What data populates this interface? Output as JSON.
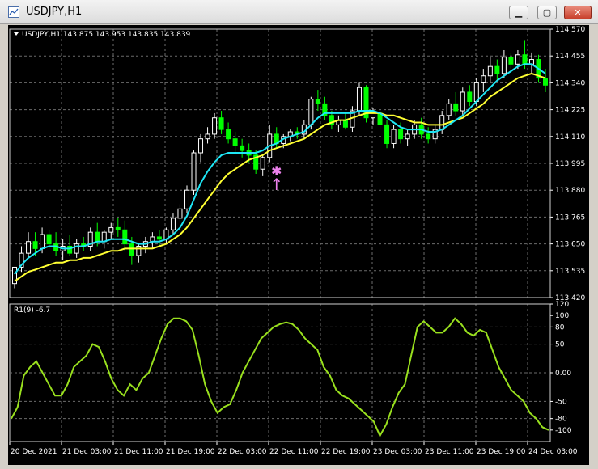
{
  "window": {
    "title": "USDJPY,H1",
    "min_glyph": "▁",
    "max_glyph": "▢",
    "close_glyph": "✕",
    "icon": "chart-app-icon"
  },
  "colors": {
    "bg": "#000000",
    "grid": "#6b6b6b",
    "bull": "#ffffff",
    "bear": "#00ff00",
    "ma_fast": "#1ee6f5",
    "ma_slow": "#ffff32",
    "indicator": "#99e01e",
    "signal": "#ee82ee"
  },
  "chart_data": [
    {
      "type": "candlestick",
      "symbol_label": "USDJPY,H1",
      "ohlc_label": "143.875 143.953 143.835 143.839",
      "y_ticks": [
        "114.570",
        "114.455",
        "114.340",
        "114.225",
        "114.110",
        "113.995",
        "113.880",
        "113.765",
        "113.650",
        "113.535",
        "113.420"
      ],
      "ylim": [
        113.42,
        114.57
      ],
      "x_ticks": [
        "20 Dec 2021",
        "21 Dec 03:00",
        "21 Dec 11:00",
        "21 Dec 19:00",
        "22 Dec 03:00",
        "22 Dec 11:00",
        "22 Dec 19:00",
        "23 Dec 03:00",
        "23 Dec 11:00",
        "23 Dec 19:00",
        "24 Dec 03:00"
      ],
      "candles": [
        [
          113.48,
          113.55,
          113.46,
          113.55
        ],
        [
          113.55,
          113.64,
          113.53,
          113.61
        ],
        [
          113.61,
          113.7,
          113.59,
          113.66
        ],
        [
          113.66,
          113.7,
          113.6,
          113.63
        ],
        [
          113.63,
          113.72,
          113.61,
          113.69
        ],
        [
          113.69,
          113.71,
          113.63,
          113.65
        ],
        [
          113.65,
          113.7,
          113.6,
          113.62
        ],
        [
          113.62,
          113.67,
          113.58,
          113.64
        ],
        [
          113.64,
          113.69,
          113.6,
          113.61
        ],
        [
          113.61,
          113.67,
          113.59,
          113.65
        ],
        [
          113.65,
          113.68,
          113.62,
          113.64
        ],
        [
          113.64,
          113.72,
          113.62,
          113.7
        ],
        [
          113.7,
          113.74,
          113.64,
          113.66
        ],
        [
          113.66,
          113.71,
          113.63,
          113.7
        ],
        [
          113.7,
          113.74,
          113.67,
          113.72
        ],
        [
          113.72,
          113.76,
          113.68,
          113.71
        ],
        [
          113.71,
          113.75,
          113.62,
          113.65
        ],
        [
          113.65,
          113.68,
          113.56,
          113.6
        ],
        [
          113.6,
          113.65,
          113.57,
          113.64
        ],
        [
          113.64,
          113.68,
          113.61,
          113.66
        ],
        [
          113.66,
          113.7,
          113.63,
          113.68
        ],
        [
          113.68,
          113.71,
          113.64,
          113.67
        ],
        [
          113.67,
          113.72,
          113.65,
          113.71
        ],
        [
          113.71,
          113.78,
          113.69,
          113.76
        ],
        [
          113.76,
          113.82,
          113.74,
          113.8
        ],
        [
          113.8,
          113.9,
          113.78,
          113.88
        ],
        [
          113.88,
          114.05,
          113.86,
          114.04
        ],
        [
          114.04,
          114.12,
          114.0,
          114.1
        ],
        [
          114.1,
          114.15,
          114.08,
          114.12
        ],
        [
          114.12,
          114.21,
          114.1,
          114.19
        ],
        [
          114.19,
          114.22,
          114.12,
          114.14
        ],
        [
          114.14,
          114.17,
          114.08,
          114.1
        ],
        [
          114.1,
          114.13,
          114.04,
          114.07
        ],
        [
          114.07,
          114.1,
          114.02,
          114.05
        ],
        [
          114.05,
          114.08,
          114.0,
          114.03
        ],
        [
          114.03,
          114.05,
          113.95,
          113.97
        ],
        [
          113.97,
          114.03,
          113.94,
          114.02
        ],
        [
          114.02,
          114.16,
          114.0,
          114.12
        ],
        [
          114.12,
          114.15,
          114.06,
          114.08
        ],
        [
          114.08,
          114.12,
          114.06,
          114.11
        ],
        [
          114.11,
          114.14,
          114.09,
          114.13
        ],
        [
          114.13,
          114.15,
          114.1,
          114.12
        ],
        [
          114.12,
          114.18,
          114.1,
          114.16
        ],
        [
          114.16,
          114.28,
          114.14,
          114.27
        ],
        [
          114.27,
          114.31,
          114.22,
          114.25
        ],
        [
          114.25,
          114.28,
          114.18,
          114.2
        ],
        [
          114.2,
          114.22,
          114.14,
          114.16
        ],
        [
          114.16,
          114.2,
          114.13,
          114.18
        ],
        [
          114.18,
          114.21,
          114.14,
          114.15
        ],
        [
          114.15,
          114.24,
          114.13,
          114.22
        ],
        [
          114.22,
          114.34,
          114.2,
          114.32
        ],
        [
          114.32,
          114.33,
          114.17,
          114.19
        ],
        [
          114.19,
          114.23,
          114.16,
          114.21
        ],
        [
          114.21,
          114.22,
          114.14,
          114.16
        ],
        [
          114.16,
          114.18,
          114.06,
          114.08
        ],
        [
          114.08,
          114.16,
          114.06,
          114.14
        ],
        [
          114.14,
          114.17,
          114.08,
          114.1
        ],
        [
          114.1,
          114.14,
          114.07,
          114.12
        ],
        [
          114.12,
          114.18,
          114.1,
          114.16
        ],
        [
          114.16,
          114.19,
          114.1,
          114.12
        ],
        [
          114.12,
          114.15,
          114.08,
          114.1
        ],
        [
          114.1,
          114.16,
          114.08,
          114.14
        ],
        [
          114.14,
          114.22,
          114.12,
          114.2
        ],
        [
          114.2,
          114.27,
          114.18,
          114.25
        ],
        [
          114.25,
          114.3,
          114.2,
          114.22
        ],
        [
          114.22,
          114.32,
          114.2,
          114.3
        ],
        [
          114.3,
          114.33,
          114.24,
          114.26
        ],
        [
          114.26,
          114.36,
          114.24,
          114.34
        ],
        [
          114.34,
          114.4,
          114.3,
          114.37
        ],
        [
          114.37,
          114.45,
          114.34,
          114.41
        ],
        [
          114.41,
          114.44,
          114.35,
          114.38
        ],
        [
          114.38,
          114.48,
          114.36,
          114.45
        ],
        [
          114.45,
          114.47,
          114.4,
          114.42
        ],
        [
          114.42,
          114.48,
          114.4,
          114.46
        ],
        [
          114.46,
          114.52,
          114.4,
          114.42
        ],
        [
          114.42,
          114.47,
          114.38,
          114.44
        ],
        [
          114.44,
          114.46,
          114.34,
          114.36
        ],
        [
          114.36,
          114.4,
          114.3,
          114.33
        ]
      ],
      "ma_fast": [
        113.52,
        113.56,
        113.59,
        113.61,
        113.63,
        113.64,
        113.64,
        113.63,
        113.63,
        113.64,
        113.64,
        113.65,
        113.66,
        113.66,
        113.67,
        113.67,
        113.67,
        113.66,
        113.65,
        113.65,
        113.66,
        113.66,
        113.67,
        113.69,
        113.72,
        113.77,
        113.84,
        113.91,
        113.96,
        114.0,
        114.03,
        114.04,
        114.04,
        114.04,
        114.04,
        114.04,
        114.05,
        114.07,
        114.08,
        114.1,
        114.11,
        114.12,
        114.13,
        114.16,
        114.19,
        114.21,
        114.21,
        114.21,
        114.21,
        114.21,
        114.22,
        114.22,
        114.22,
        114.21,
        114.19,
        114.17,
        114.15,
        114.14,
        114.14,
        114.14,
        114.13,
        114.13,
        114.14,
        114.16,
        114.18,
        114.2,
        114.23,
        114.26,
        114.29,
        114.32,
        114.35,
        114.37,
        114.39,
        114.41,
        114.42,
        114.42,
        114.4,
        114.38
      ],
      "ma_slow": [
        113.49,
        113.51,
        113.53,
        113.54,
        113.55,
        113.56,
        113.57,
        113.57,
        113.58,
        113.58,
        113.59,
        113.59,
        113.6,
        113.61,
        113.62,
        113.62,
        113.63,
        113.63,
        113.63,
        113.63,
        113.63,
        113.64,
        113.65,
        113.67,
        113.69,
        113.72,
        113.76,
        113.8,
        113.84,
        113.88,
        113.92,
        113.95,
        113.97,
        113.99,
        114.01,
        114.02,
        114.03,
        114.05,
        114.06,
        114.07,
        114.08,
        114.09,
        114.1,
        114.12,
        114.14,
        114.16,
        114.17,
        114.18,
        114.18,
        114.19,
        114.2,
        114.21,
        114.21,
        114.21,
        114.2,
        114.2,
        114.19,
        114.18,
        114.17,
        114.17,
        114.16,
        114.16,
        114.16,
        114.17,
        114.18,
        114.19,
        114.21,
        114.23,
        114.25,
        114.28,
        114.3,
        114.32,
        114.34,
        114.36,
        114.37,
        114.38,
        114.37,
        114.36
      ],
      "signals": [
        {
          "candle": 38,
          "price": 113.96,
          "glyph": "✱"
        },
        {
          "candle": 38,
          "price": 113.93,
          "glyph": "↑"
        }
      ]
    },
    {
      "type": "line",
      "label": "R1(9) -6.7",
      "y_ticks": [
        "120",
        "100",
        "80",
        "50",
        "0.00",
        "-50",
        "-80",
        "-100"
      ],
      "ylim": [
        -120,
        120
      ],
      "values": [
        -80,
        -60,
        -5,
        10,
        20,
        0,
        -20,
        -40,
        -40,
        -20,
        10,
        20,
        30,
        50,
        45,
        20,
        -10,
        -30,
        -40,
        -20,
        -30,
        -10,
        0,
        30,
        60,
        85,
        95,
        95,
        90,
        75,
        30,
        -20,
        -50,
        -70,
        -60,
        -55,
        -30,
        0,
        20,
        40,
        60,
        70,
        80,
        85,
        88,
        85,
        75,
        60,
        50,
        40,
        10,
        -5,
        -30,
        -40,
        -45,
        -55,
        -65,
        -75,
        -85,
        -110,
        -90,
        -60,
        -35,
        -20,
        30,
        80,
        90,
        80,
        70,
        70,
        80,
        95,
        85,
        70,
        65,
        75,
        70,
        40,
        10,
        -10,
        -30,
        -40,
        -50,
        -70,
        -80,
        -95,
        -100
      ]
    }
  ]
}
